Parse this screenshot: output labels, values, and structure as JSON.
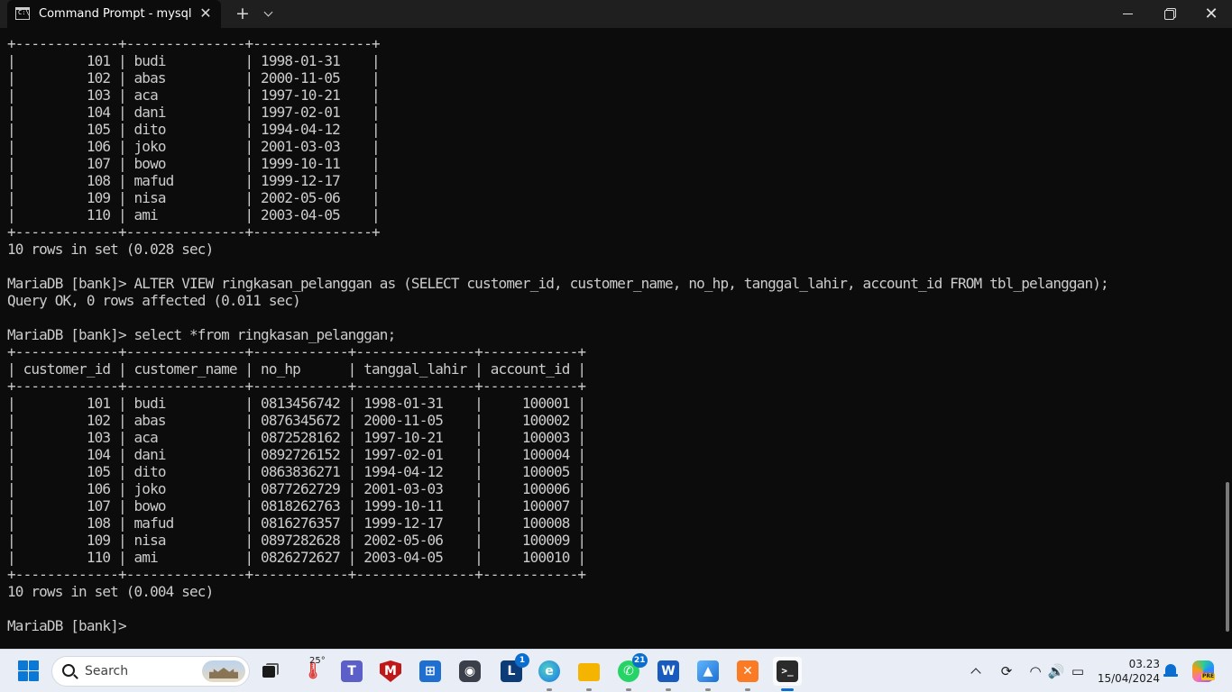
{
  "window": {
    "tab_title": "Command Prompt - mysql  -u",
    "tab_icon_text": "C:\\"
  },
  "terminal": {
    "text": "+-------------+---------------+---------------+\n|         101 | budi          | 1998-01-31    |\n|         102 | abas          | 2000-11-05    |\n|         103 | aca           | 1997-10-21    |\n|         104 | dani          | 1997-02-01    |\n|         105 | dito          | 1994-04-12    |\n|         106 | joko          | 2001-03-03    |\n|         107 | bowo          | 1999-10-11    |\n|         108 | mafud         | 1999-12-17    |\n|         109 | nisa          | 2002-05-06    |\n|         110 | ami           | 2003-04-05    |\n+-------------+---------------+---------------+\n10 rows in set (0.028 sec)\n\nMariaDB [bank]> ALTER VIEW ringkasan_pelanggan as (SELECT customer_id, customer_name, no_hp, tanggal_lahir, account_id FROM tbl_pelanggan);\nQuery OK, 0 rows affected (0.011 sec)\n\nMariaDB [bank]> select *from ringkasan_pelanggan;\n+-------------+---------------+------------+---------------+------------+\n| customer_id | customer_name | no_hp      | tanggal_lahir | account_id |\n+-------------+---------------+------------+---------------+------------+\n|         101 | budi          | 0813456742 | 1998-01-31    |     100001 |\n|         102 | abas          | 0876345672 | 2000-11-05    |     100002 |\n|         103 | aca           | 0872528162 | 1997-10-21    |     100003 |\n|         104 | dani          | 0892726152 | 1997-02-01    |     100004 |\n|         105 | dito          | 0863836271 | 1994-04-12    |     100005 |\n|         106 | joko          | 0877262729 | 2001-03-03    |     100006 |\n|         107 | bowo          | 0818262763 | 1999-10-11    |     100007 |\n|         108 | mafud         | 0816276357 | 1999-12-17    |     100008 |\n|         109 | nisa          | 0897282628 | 2002-05-06    |     100009 |\n|         110 | ami           | 0826272627 | 2003-04-05    |     100010 |\n+-------------+---------------+------------+---------------+------------+\n10 rows in set (0.004 sec)\n\nMariaDB [bank]> "
  },
  "taskbar": {
    "search_label": "Search",
    "weather_temp": "25°",
    "badges": {
      "lexicon": "1",
      "whatsapp": "21"
    },
    "apps": [
      {
        "name": "task-view-icon",
        "glyph": ""
      },
      {
        "name": "weather-icon",
        "glyph": "🌡"
      },
      {
        "name": "teams-icon",
        "glyph": "T"
      },
      {
        "name": "mcafee-icon",
        "glyph": "M"
      },
      {
        "name": "microsoft-store-icon",
        "glyph": "⊞"
      },
      {
        "name": "camera-icon",
        "glyph": "◉"
      },
      {
        "name": "lexicon-icon",
        "glyph": "L"
      },
      {
        "name": "edge-icon",
        "glyph": "e"
      },
      {
        "name": "file-explorer-icon",
        "glyph": ""
      },
      {
        "name": "whatsapp-icon",
        "glyph": "✆"
      },
      {
        "name": "word-icon",
        "glyph": "W"
      },
      {
        "name": "photos-icon",
        "glyph": "▲"
      },
      {
        "name": "xampp-icon",
        "glyph": "✕"
      },
      {
        "name": "terminal-icon",
        "glyph": ">_"
      }
    ],
    "clock": {
      "time": "03.23",
      "date": "15/04/2024"
    },
    "copilot_badge": "PRE"
  },
  "colors": {
    "terminal_bg": "#0c0c0c",
    "terminal_fg": "#cccccc",
    "titlebar_bg": "#1f1f1f",
    "taskbar_bg": "#e9eef6",
    "accent": "#0a6ed1"
  }
}
